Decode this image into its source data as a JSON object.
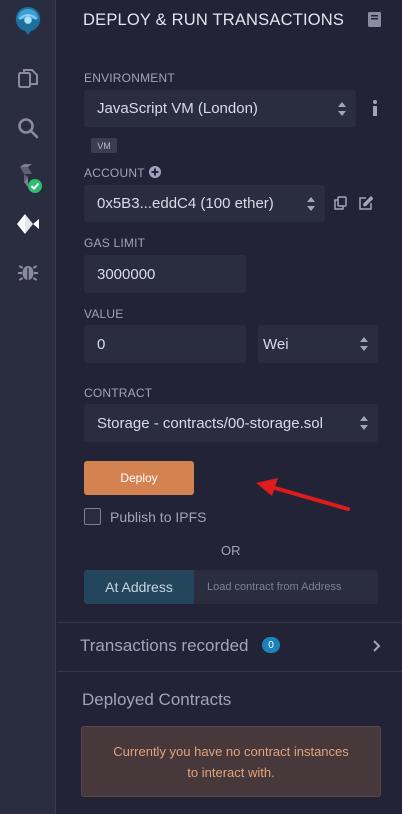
{
  "app": {
    "panel_title": "DEPLOY & RUN TRANSACTIONS",
    "icons": [
      "remix-logo-icon",
      "file-explorer-icon",
      "search-icon",
      "solidity-compiler-icon",
      "deploy-run-icon",
      "debugger-icon",
      "documentation-icon",
      "info-icon",
      "plus-circle-icon",
      "copy-icon",
      "edit-icon",
      "chevron-right-icon"
    ],
    "accent_color": "#d4824f"
  },
  "environment": {
    "label": "ENVIRONMENT",
    "selected": "JavaScript VM (London)",
    "badge": "VM"
  },
  "account": {
    "label": "ACCOUNT",
    "selected": "0x5B3...eddC4 (100 ether)"
  },
  "gas_limit": {
    "label": "GAS LIMIT",
    "value": "3000000"
  },
  "value": {
    "label": "VALUE",
    "amount": "0",
    "unit": "Wei"
  },
  "contract": {
    "label": "CONTRACT",
    "selected": "Storage - contracts/00-storage.sol"
  },
  "actions": {
    "deploy_label": "Deploy",
    "publish_label": "Publish to IPFS",
    "publish_checked": false,
    "or_label": "OR",
    "at_address_label": "At Address",
    "at_address_placeholder": "Load contract from Address"
  },
  "transactions": {
    "title": "Transactions recorded",
    "count": "0"
  },
  "deployed": {
    "title": "Deployed Contracts",
    "empty_message": "Currently you have no contract instances to interact with."
  }
}
